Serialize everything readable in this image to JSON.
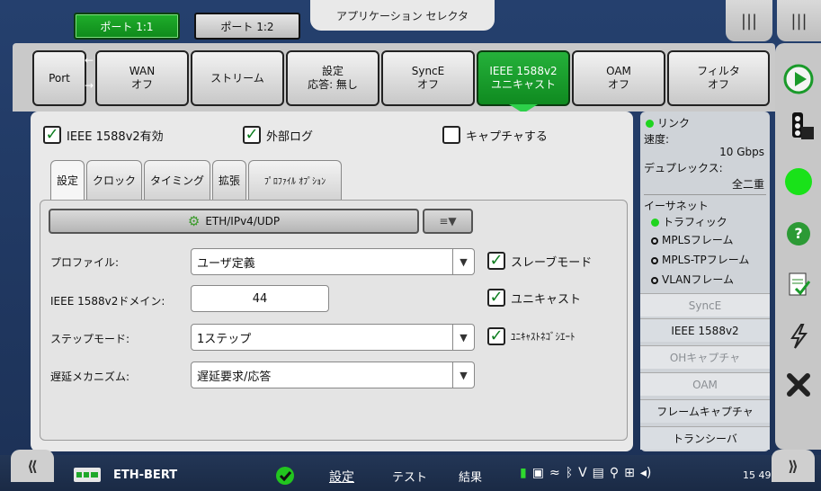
{
  "topbar": {
    "port1_label": "ポート 1:1",
    "port2_label": "ポート 1:2",
    "app_selector_label": "アプリケーション セレクタ",
    "menu_icon_glyph": "|||"
  },
  "module_tabs": [
    {
      "label": "Port"
    },
    {
      "label": "WAN\nオフ"
    },
    {
      "label": "ストリーム"
    },
    {
      "label": "設定\n応答: 無し"
    },
    {
      "label": "SyncE\nオフ"
    },
    {
      "label": "IEEE 1588v2\nユニキャスト"
    },
    {
      "label": "OAM\nオフ"
    },
    {
      "label": "フィルタ\nオフ"
    }
  ],
  "main": {
    "enable_label": "IEEE 1588v2有効",
    "enable_checked": true,
    "extlog_label": "外部ログ",
    "extlog_checked": true,
    "capture_label": "キャプチャする",
    "capture_checked": false,
    "subtabs": [
      "設定",
      "クロック",
      "タイミング",
      "拡張",
      "ﾌﾟﾛﾌｧｲﾙ ｵﾌﾟｼｮﾝ"
    ],
    "encap_label": "ETH/IPv4/UDP",
    "profile_label": "プロファイル:",
    "profile_value": "ユーザ定義",
    "domain_label": "IEEE 1588v2ドメイン:",
    "domain_value": "44",
    "step_label": "ステップモード:",
    "step_value": "1ステップ",
    "delay_label": "遅延メカニズム:",
    "delay_value": "遅延要求/応答",
    "slave_label": "スレーブモード",
    "unicast_label": "ユニキャスト",
    "unicast_neg_label": "ﾕﾆｷｬｽﾄﾈｺﾞｼｴｰﾄ"
  },
  "status": {
    "link_label": "リンク",
    "speed_label": "速度:",
    "speed_value": "10 Gbps",
    "duplex_label": "デュプレックス:",
    "duplex_value": "全二重",
    "ethernet_label": "イーサネット",
    "traffic_label": "トラフィック",
    "mpls_label": "MPLSフレーム",
    "mplstp_label": "MPLS-TPフレーム",
    "vlan_label": "VLANフレーム",
    "buttons": [
      {
        "label": "SyncE"
      },
      {
        "label": "IEEE 1588v2"
      },
      {
        "label": "OHキャプチャ"
      },
      {
        "label": "OAM"
      },
      {
        "label": "フレームキャプチャ"
      },
      {
        "label": "トランシーバ"
      }
    ]
  },
  "bottombar": {
    "test_name": "ETH-BERT",
    "setup_label": "設定",
    "test_label": "テスト",
    "results_label": "結果",
    "time": "15 49"
  },
  "colors": {
    "active_green": "#14a028",
    "frame_blue": "#22395f"
  }
}
